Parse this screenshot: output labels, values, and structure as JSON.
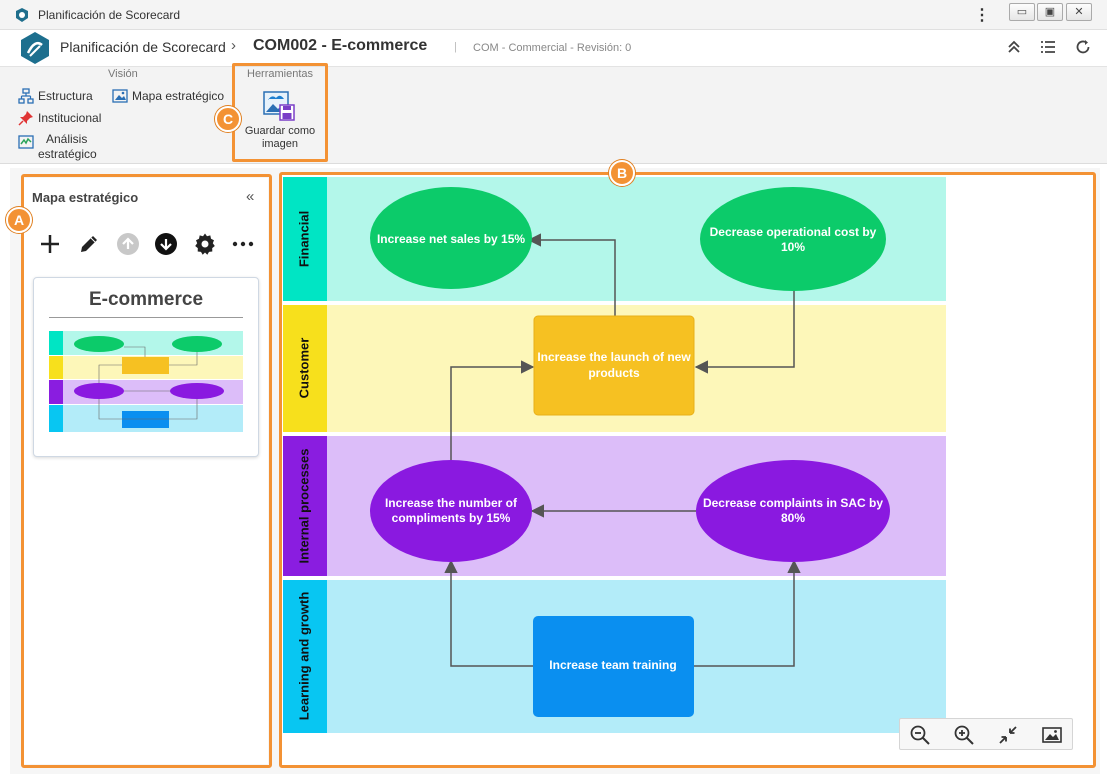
{
  "window": {
    "title": "Planificación de Scorecard",
    "kebab": "⋮",
    "min": "▭",
    "max": "▣",
    "close": "✕"
  },
  "header": {
    "root": "Planificación de Scorecard",
    "separator": "›",
    "current": "COM002 - E-commerce",
    "bar": "|",
    "subtitle": "COM - Commercial - Revisión: 0"
  },
  "ribbon": {
    "vision": {
      "title": "Visión",
      "estructura": "Estructura",
      "mapa": "Mapa estratégico",
      "institucional": "Institucional",
      "analisis_1": "Análisis",
      "analisis_2": "estratégico"
    },
    "tools": {
      "title": "Herramientas",
      "save_1": "Guardar como",
      "save_2": "imagen"
    }
  },
  "panel": {
    "title": "Mapa estratégico",
    "collapse": "«",
    "card_title": "E-commerce"
  },
  "markers": {
    "a": "A",
    "b": "B",
    "c": "C"
  },
  "map": {
    "lanes": [
      {
        "label": "Financial",
        "head": "#00e5c4",
        "body": "#b3f7ea"
      },
      {
        "label": "Customer",
        "head": "#f7e01c",
        "body": "#fdf7b9"
      },
      {
        "label": "Internal processes",
        "head": "#8a1de0",
        "body": "#dcbdf9"
      },
      {
        "label": "Learning and growth",
        "head": "#08c6f2",
        "body": "#b3ecf9"
      }
    ],
    "objectives": {
      "net_sales": "Increase net sales by 15%",
      "op_cost_1": "Decrease operational cost by",
      "op_cost_2": "10%",
      "launch_1": "Increase the launch of new",
      "launch_2": "products",
      "compliments_1": "Increase the number of",
      "compliments_2": "compliments by 15%",
      "complaints_1": "Decrease complaints in SAC by",
      "complaints_2": "80%",
      "training": "Increase team training"
    },
    "colors": {
      "financial_node": "#0ccb6a",
      "customer_node": "#f6c122",
      "internal_node": "#8a19e0",
      "learning_node": "#0a8ff0",
      "accent": "#f39234"
    }
  }
}
